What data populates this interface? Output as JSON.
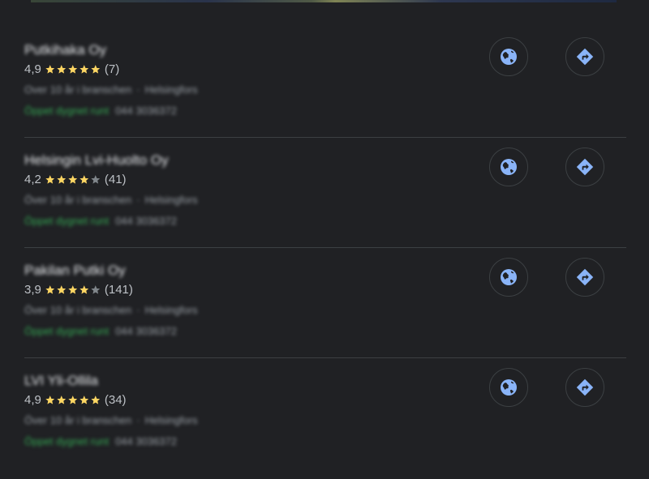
{
  "accent_color": "#8ab4f8",
  "star_color": "#fdd663",
  "star_empty_color": "#80868b",
  "open_color": "#34a853",
  "listings": [
    {
      "name": "Putkihaka Oy",
      "rating": "4,9",
      "stars_filled": 5,
      "review_count": "(7)",
      "experience": "Over 10 år i branschen",
      "location": "Helsingfors",
      "hours": "Öppet dygnet runt",
      "phone": "044 3036372",
      "website_icon": "globe-icon",
      "directions_icon": "directions-icon"
    },
    {
      "name": "Helsingin Lvi-Huolto Oy",
      "rating": "4,2",
      "stars_filled": 4,
      "review_count": "(41)",
      "experience": "Över 10 år i branschen",
      "location": "Helsingfors",
      "hours": "Öppet dygnet runt",
      "phone": "044 3036372",
      "website_icon": "globe-icon",
      "directions_icon": "directions-icon"
    },
    {
      "name": "Pakilan Putki Oy",
      "rating": "3,9",
      "stars_filled": 4,
      "review_count": "(141)",
      "experience": "Över 10 år i branschen",
      "location": "Helsingfors",
      "hours": "Öppet dygnet runt",
      "phone": "044 3036372",
      "website_icon": "globe-icon",
      "directions_icon": "directions-icon"
    },
    {
      "name": "LVI Yli-Ollila",
      "rating": "4,9",
      "stars_filled": 5,
      "review_count": "(34)",
      "experience": "Över 10 år i branschen",
      "location": "Helsingfors",
      "hours": "Öppet dygnet runt",
      "phone": "044 3036372",
      "website_icon": "globe-icon",
      "directions_icon": "directions-icon"
    }
  ]
}
